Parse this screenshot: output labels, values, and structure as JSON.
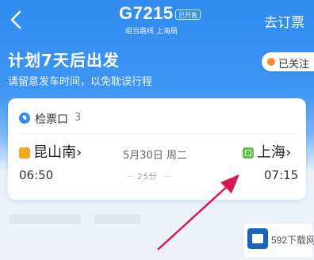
{
  "header": {
    "train_number": "G7215",
    "train_tag": "已开售",
    "route_subtitle": "组当路线 上海局",
    "book_label": "去订票"
  },
  "hero": {
    "title": "计划7天后出发",
    "subtitle": "请留意发车时间，以免耽误行程",
    "follow_label": "已关注"
  },
  "trip_card": {
    "gate_label": "检票口",
    "gate_number": "3",
    "from_station": "昆山南›",
    "to_station": "上海›",
    "date": "5月30日 周二",
    "departure_time": "06:50",
    "arrival_time": "07:15",
    "duration": "25分"
  },
  "watermark": {
    "text": "592下载网"
  },
  "colors": {
    "primary_blue": "#2f8bf0",
    "arrow_red": "#d8174f",
    "from_icon": "#f5a623",
    "to_icon": "#5fc24a"
  }
}
